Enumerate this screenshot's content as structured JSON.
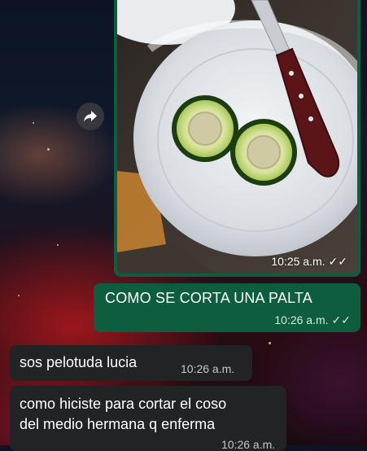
{
  "chat": {
    "forwarded_image": {
      "time": "10:25 a.m."
    },
    "outgoing_message": {
      "text": "COMO SE CORTA UNA PALTA",
      "time": "10:26 a.m."
    },
    "incoming_messages": [
      {
        "text": "sos pelotuda lucia",
        "time": "10:26 a.m."
      },
      {
        "text_line1": "como hiciste para cortar el coso",
        "text_line2": "del medio hermana q enferma",
        "time": "10:26 a.m."
      }
    ]
  },
  "icons": {
    "forward": "forward-arrow-icon",
    "read_receipt": "double-check-icon"
  },
  "colors": {
    "outgoing_bubble": "#0e5d3f",
    "incoming_bubble": "#222325",
    "text": "#ffffff"
  }
}
